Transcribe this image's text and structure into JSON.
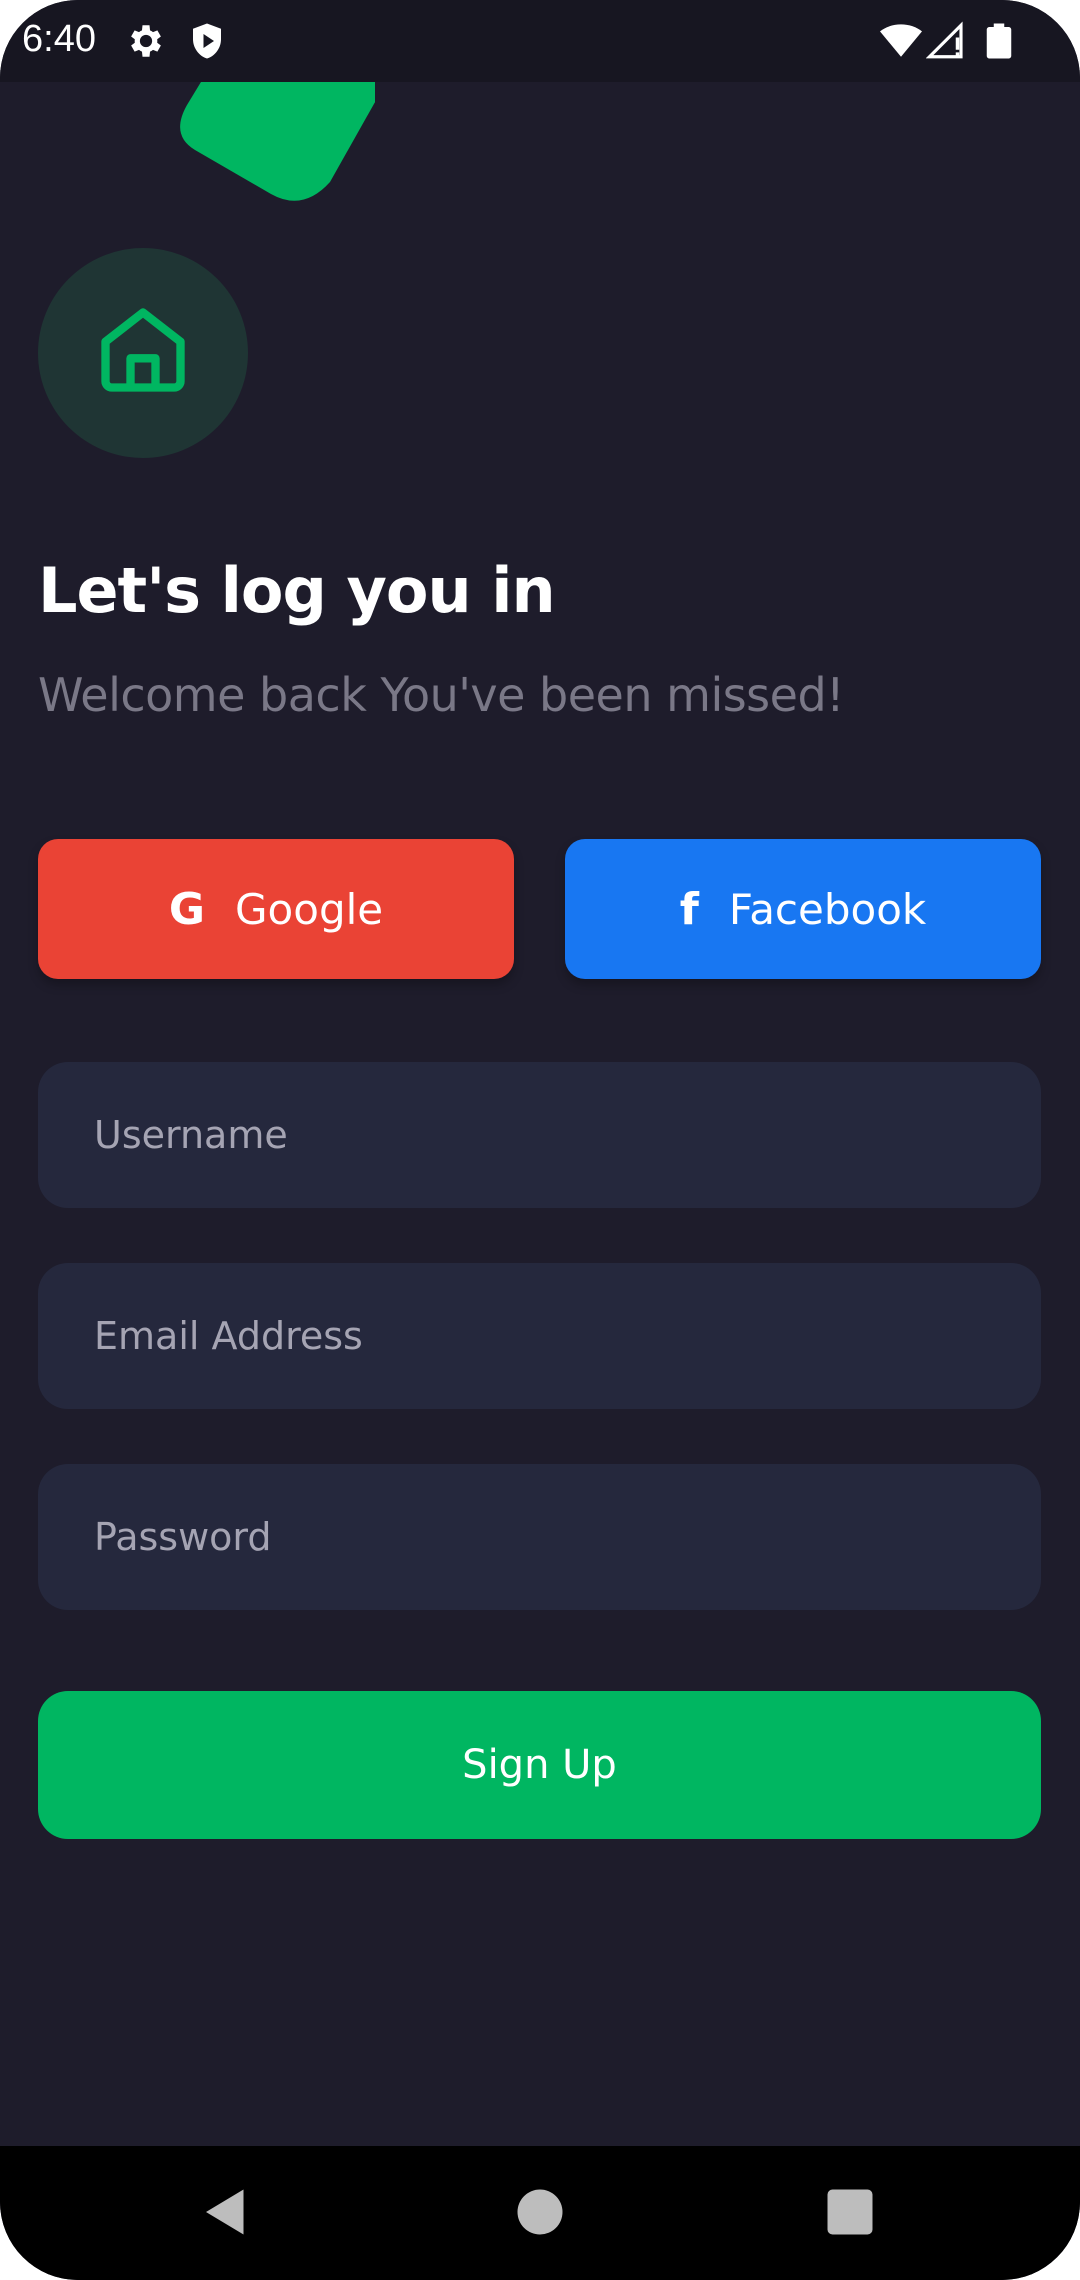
{
  "status_bar": {
    "time": "6:40",
    "icons_left": [
      "gear-icon",
      "shield-icon"
    ],
    "icons_right": [
      "wifi-icon",
      "cellular-signal-icon",
      "battery-icon"
    ]
  },
  "branding": {
    "logo_icon": "home-icon",
    "accent_color": "#00b661"
  },
  "header": {
    "title": "Let's log you in",
    "subtitle": "Welcome back You've been missed!"
  },
  "social_login": {
    "google": {
      "label": "Google",
      "icon": "G",
      "color": "#ea4335"
    },
    "facebook": {
      "label": "Facebook",
      "icon": "f",
      "color": "#1877f2"
    }
  },
  "form": {
    "username": {
      "placeholder": "Username",
      "value": ""
    },
    "email": {
      "placeholder": "Email Address",
      "value": ""
    },
    "password": {
      "placeholder": "Password",
      "value": ""
    },
    "submit_label": "Sign Up"
  },
  "nav_bar": {
    "buttons": [
      "back-icon",
      "home-circle-icon",
      "recents-square-icon"
    ]
  }
}
